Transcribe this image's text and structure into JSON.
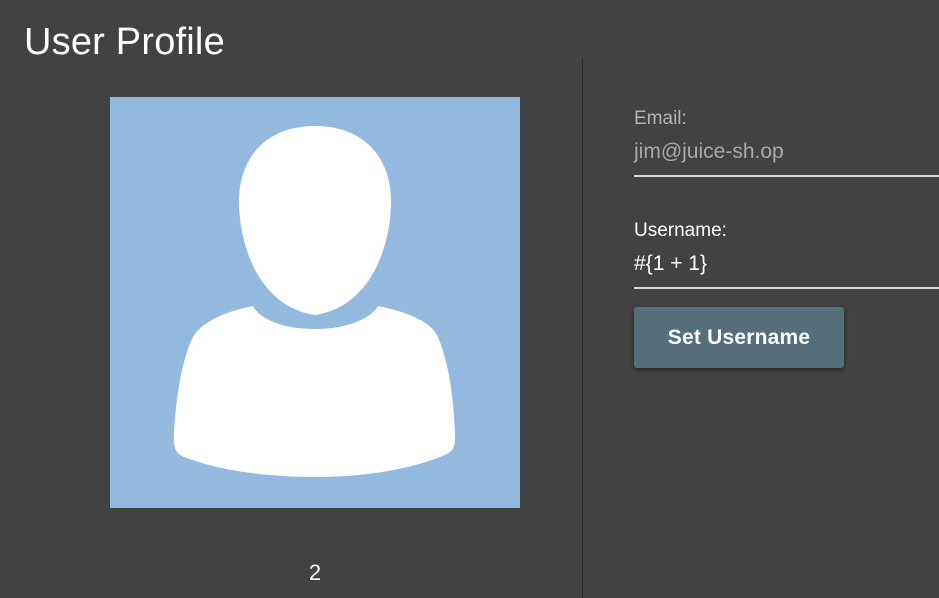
{
  "page": {
    "title": "User Profile"
  },
  "profile": {
    "avatar_icon": "user-silhouette-icon",
    "avatar_background": "#94b9df",
    "user_number": "2"
  },
  "form": {
    "email": {
      "label": "Email:",
      "value": "jim@juice-sh.op"
    },
    "username": {
      "label": "Username:",
      "value": "#{1 + 1}"
    },
    "submit_label": "Set Username"
  },
  "colors": {
    "background": "#424242",
    "button": "#546e7a",
    "text": "#ffffff"
  }
}
